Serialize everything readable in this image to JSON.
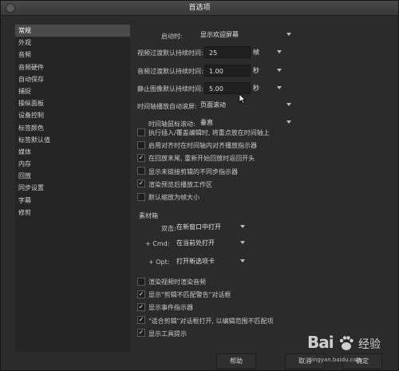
{
  "window": {
    "title": "首选项"
  },
  "sidebar": {
    "items": [
      "常规",
      "外观",
      "音频",
      "音频硬件",
      "自动保存",
      "捕捉",
      "操纵面板",
      "设备控制",
      "标签颜色",
      "标签默认值",
      "媒体",
      "内存",
      "回放",
      "同步设置",
      "字幕",
      "修剪"
    ],
    "active_index": 0
  },
  "general": {
    "startup_label": "启动时:",
    "startup_value": "显示欢迎屏幕",
    "video_transition_label": "视频过渡默认持续时间:",
    "video_transition_value": "25",
    "video_transition_unit": "帧",
    "audio_transition_label": "音频过渡默认持续时间:",
    "audio_transition_value": "1.00",
    "audio_transition_unit": "秒",
    "still_image_label": "静止图像默认持续时间:",
    "still_image_value": "5.00",
    "still_image_unit": "秒",
    "timeline_autoscroll_label": "时间轴播放自动滚屏:",
    "timeline_autoscroll_value": "页面滚动",
    "timeline_mouse_scroll_label": "时间轴鼠标滚动:",
    "timeline_mouse_scroll_value": "垂直"
  },
  "options_top": [
    {
      "label": "执行插入/覆盖编辑时, 将重点放在时间轴上",
      "checked": false
    },
    {
      "label": "启用对齐时在时间轴内对齐播放指示器",
      "checked": false
    },
    {
      "label": "在回放末尾, 重新开始回放时返回开头",
      "checked": true
    },
    {
      "label": "显示未链接剪辑的不同步指示器",
      "checked": false
    },
    {
      "label": "渲染预览后播放工作区",
      "checked": true
    },
    {
      "label": "默认缩放为帧大小",
      "checked": false
    }
  ],
  "bins": {
    "section_label": "素材箱",
    "double_click_label": "双击:",
    "double_click_value": "在新窗口中打开",
    "cmd_label": "+ Cmd:",
    "cmd_value": "在当前处打开",
    "opt_label": "+ Opt:",
    "opt_value": "打开新选项卡"
  },
  "options_bottom": [
    {
      "label": "渲染视频时渲染音频",
      "checked": false
    },
    {
      "label": "显示\"剪辑不匹配警告\"对话框",
      "checked": true
    },
    {
      "label": "显示事件指示器",
      "checked": true
    },
    {
      "label": "\"适合剪辑\"对话框打开, 以编辑范围不匹配项",
      "checked": true
    },
    {
      "label": "显示工具提示",
      "checked": true
    }
  ],
  "footer": {
    "help": "帮助",
    "cancel": "取消",
    "ok": "确定"
  },
  "watermark": {
    "brand": "Bai",
    "brand_suffix": "经验",
    "url": "jingyan.baidu.com"
  },
  "colors": {
    "background": "#2b2b2b",
    "sidebar": "#252525",
    "selection": "#4a4a4a"
  }
}
